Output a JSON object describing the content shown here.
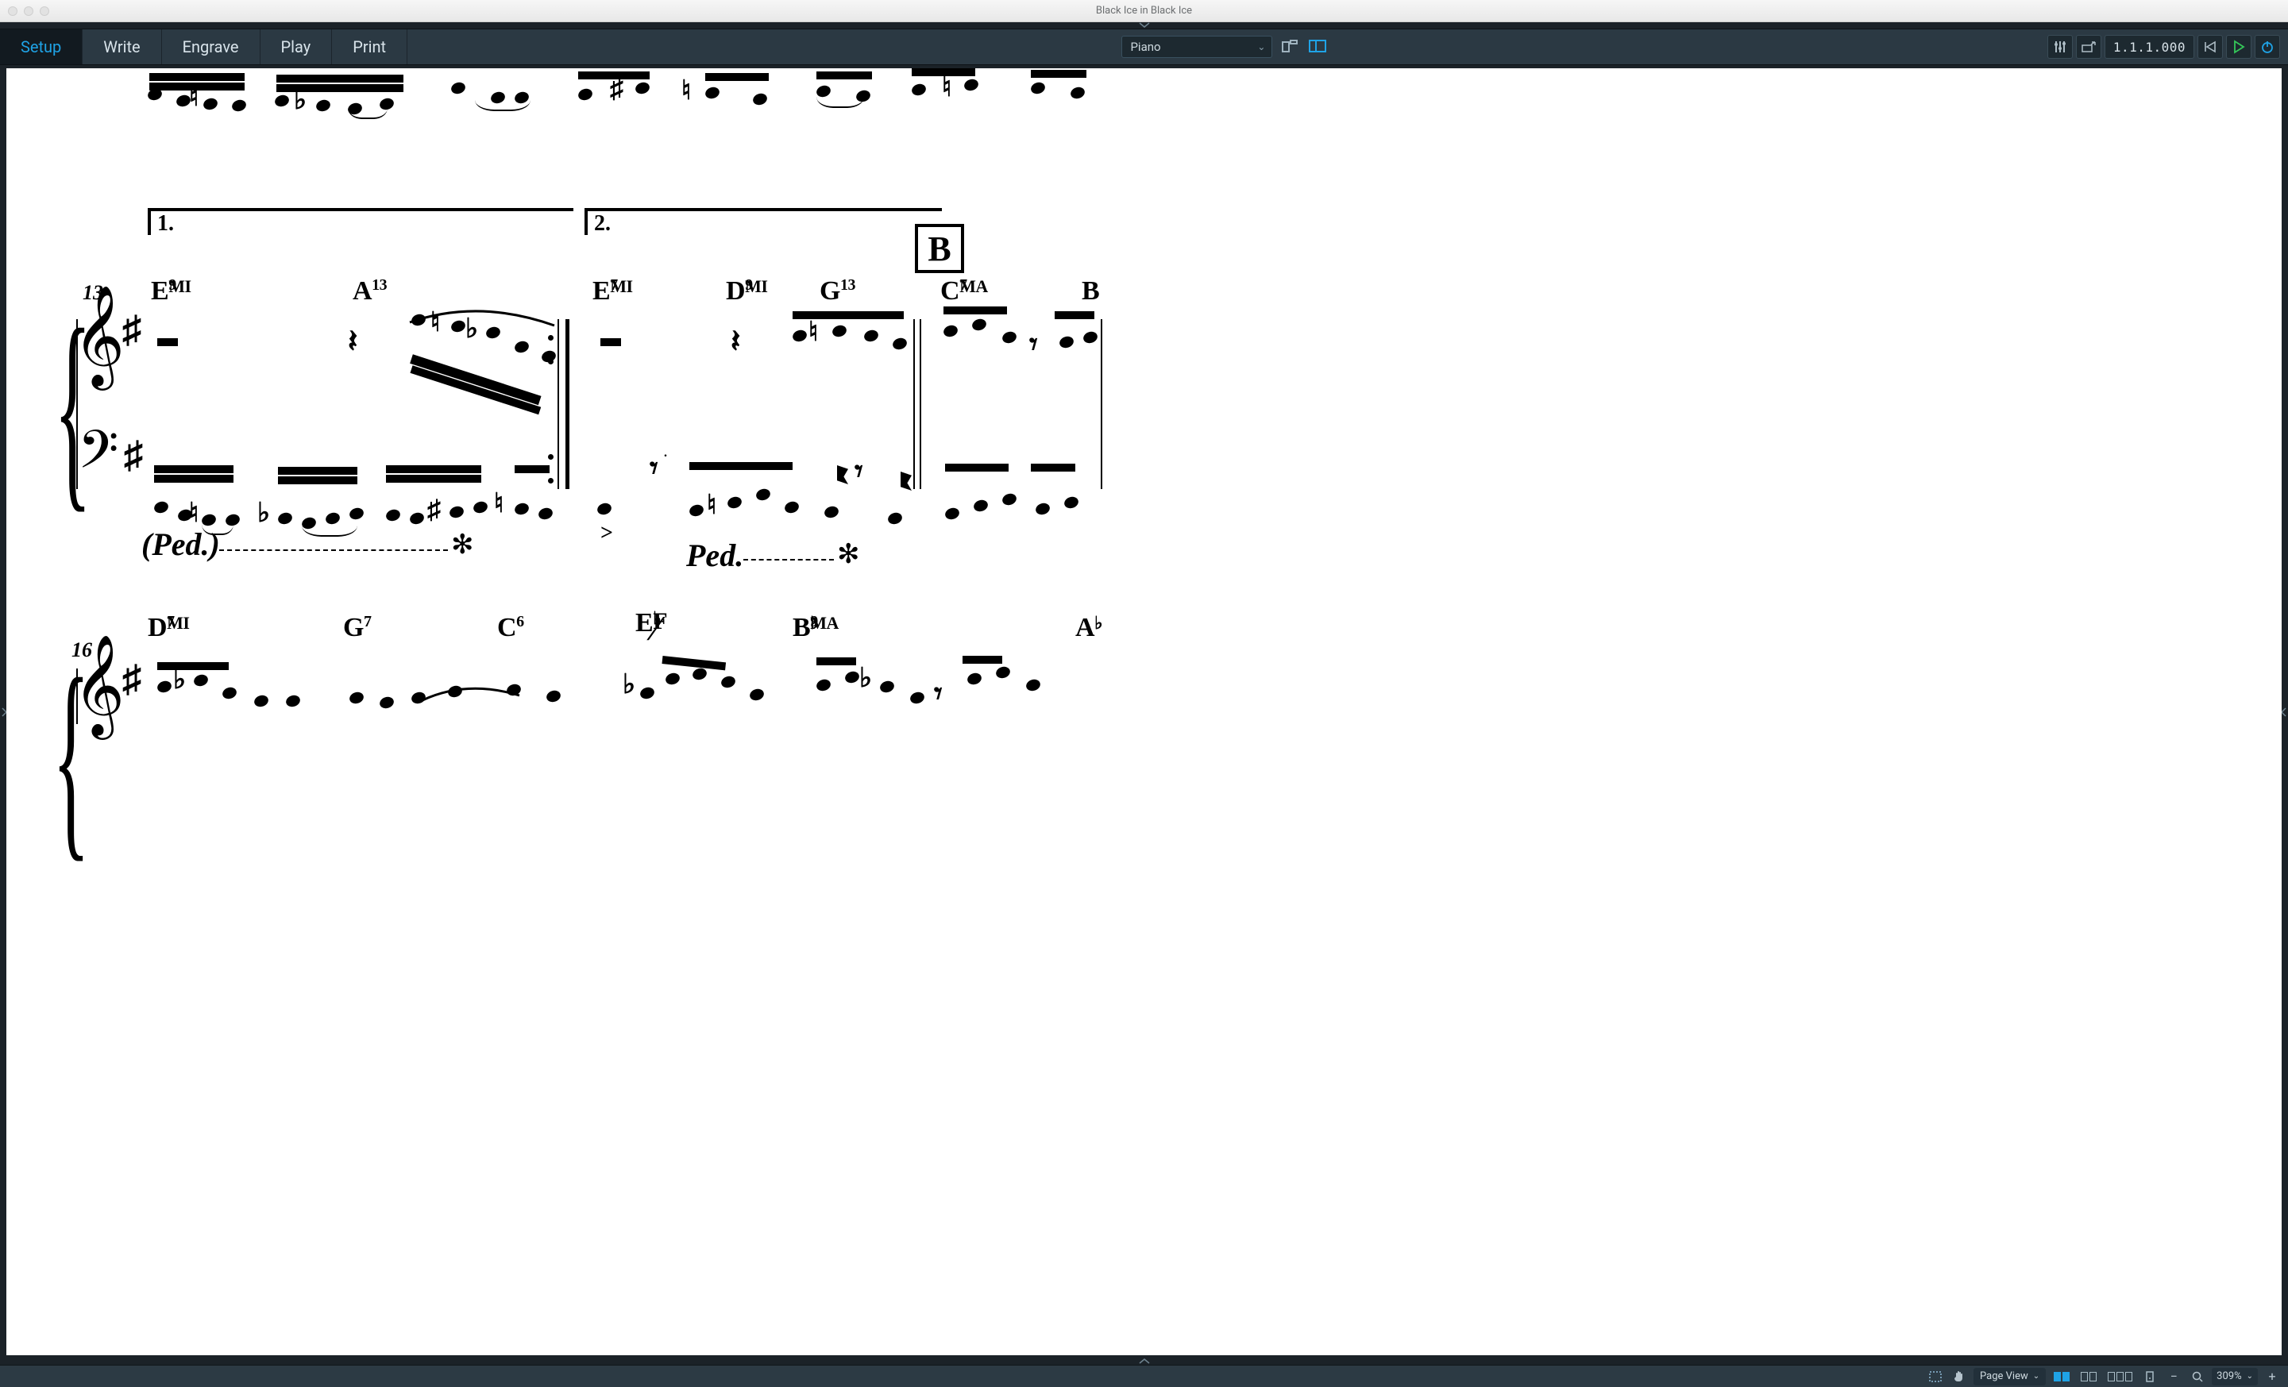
{
  "window": {
    "title": "Black Ice in Black Ice"
  },
  "modes": {
    "setup": "Setup",
    "write": "Write",
    "engrave": "Engrave",
    "play": "Play",
    "print": "Print",
    "active": "setup"
  },
  "instrument_selector": {
    "selected": "Piano"
  },
  "transport": {
    "position": "1.1.1.000"
  },
  "status_bar": {
    "view_mode": "Page View",
    "zoom": "309%"
  },
  "score": {
    "measure_numbers": {
      "sys2": "13",
      "sys3": "16"
    },
    "voltas": {
      "one": "1.",
      "two": "2."
    },
    "rehearsal_mark": "B",
    "chords_sys2": [
      {
        "root": "E",
        "qual": "MI",
        "ext": "9"
      },
      {
        "root": "A",
        "qual": "",
        "ext": "13"
      },
      {
        "root": "E",
        "qual": "MI",
        "ext": "7"
      },
      {
        "root": "D",
        "qual": "MI",
        "ext": "9"
      },
      {
        "root": "G",
        "qual": "",
        "ext": "13"
      },
      {
        "root": "C",
        "qual": "MA",
        "ext": "7"
      },
      {
        "root": "B",
        "qual": "",
        "ext": ""
      }
    ],
    "chords_sys3": [
      {
        "root": "D",
        "qual": "MI",
        "ext": "7"
      },
      {
        "root": "G",
        "qual": "",
        "ext": "7"
      },
      {
        "root": "C",
        "qual": "",
        "ext": "6"
      },
      {
        "root": "E♭/F",
        "qual": "",
        "ext": ""
      },
      {
        "root": "B♭",
        "qual": "MA",
        "ext": "9"
      },
      {
        "root": "A♭",
        "qual": "",
        "ext": ""
      }
    ],
    "pedal": {
      "continuation": "(Ped.)",
      "mark": "Ped.",
      "release": "✻"
    },
    "accent": ">"
  }
}
